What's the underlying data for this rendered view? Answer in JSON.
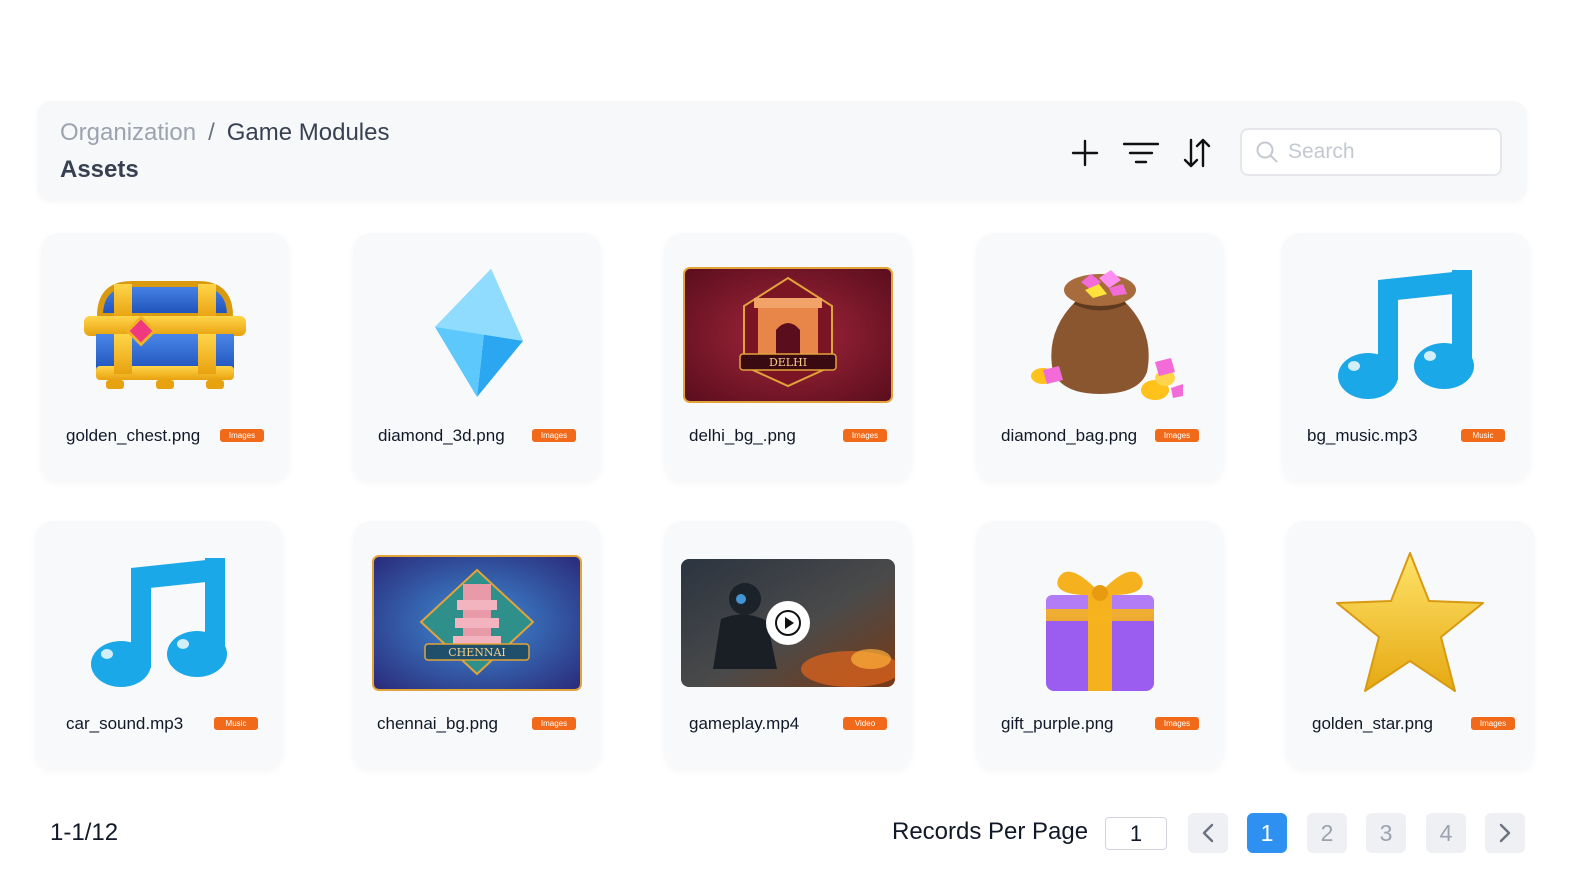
{
  "header": {
    "breadcrumb": {
      "root": "Organization",
      "separator": "/",
      "current": "Game Modules"
    },
    "title": "Assets",
    "toolbar": {
      "add_icon": "plus-icon",
      "filter_icon": "filter-icon",
      "sort_icon": "sort-icon"
    },
    "search": {
      "placeholder": "Search",
      "value": ""
    }
  },
  "assets": [
    {
      "name": "golden_chest.png",
      "badge": "Images",
      "thumbnail": "treasure-chest"
    },
    {
      "name": "diamond_3d.png",
      "badge": "Images",
      "thumbnail": "blue-diamond"
    },
    {
      "name": "delhi_bg_.png",
      "badge": "Images",
      "thumbnail": "delhi-banner",
      "caption": "DELHI"
    },
    {
      "name": "diamond_bag.png",
      "badge": "Images",
      "thumbnail": "gem-sack"
    },
    {
      "name": "bg_music.mp3",
      "badge": "Music",
      "thumbnail": "music-note"
    },
    {
      "name": "car_sound.mp3",
      "badge": "Music",
      "thumbnail": "music-note"
    },
    {
      "name": "chennai_bg.png",
      "badge": "Images",
      "thumbnail": "chennai-banner",
      "caption": "CHENNAI"
    },
    {
      "name": "gameplay.mp4",
      "badge": "Video",
      "thumbnail": "video-still"
    },
    {
      "name": "gift_purple.png",
      "badge": "Images",
      "thumbnail": "gift-box"
    },
    {
      "name": "golden_star.png",
      "badge": "Images",
      "thumbnail": "gold-star"
    }
  ],
  "footer": {
    "range": "1-1/12",
    "records_per_page_label": "Records Per Page",
    "records_per_page_value": "1",
    "pages": [
      "1",
      "2",
      "3",
      "4"
    ],
    "current_page": "1"
  },
  "colors": {
    "accent": "#2e90f0",
    "badge": "#f06a1a",
    "note": "#1ba8e8"
  }
}
